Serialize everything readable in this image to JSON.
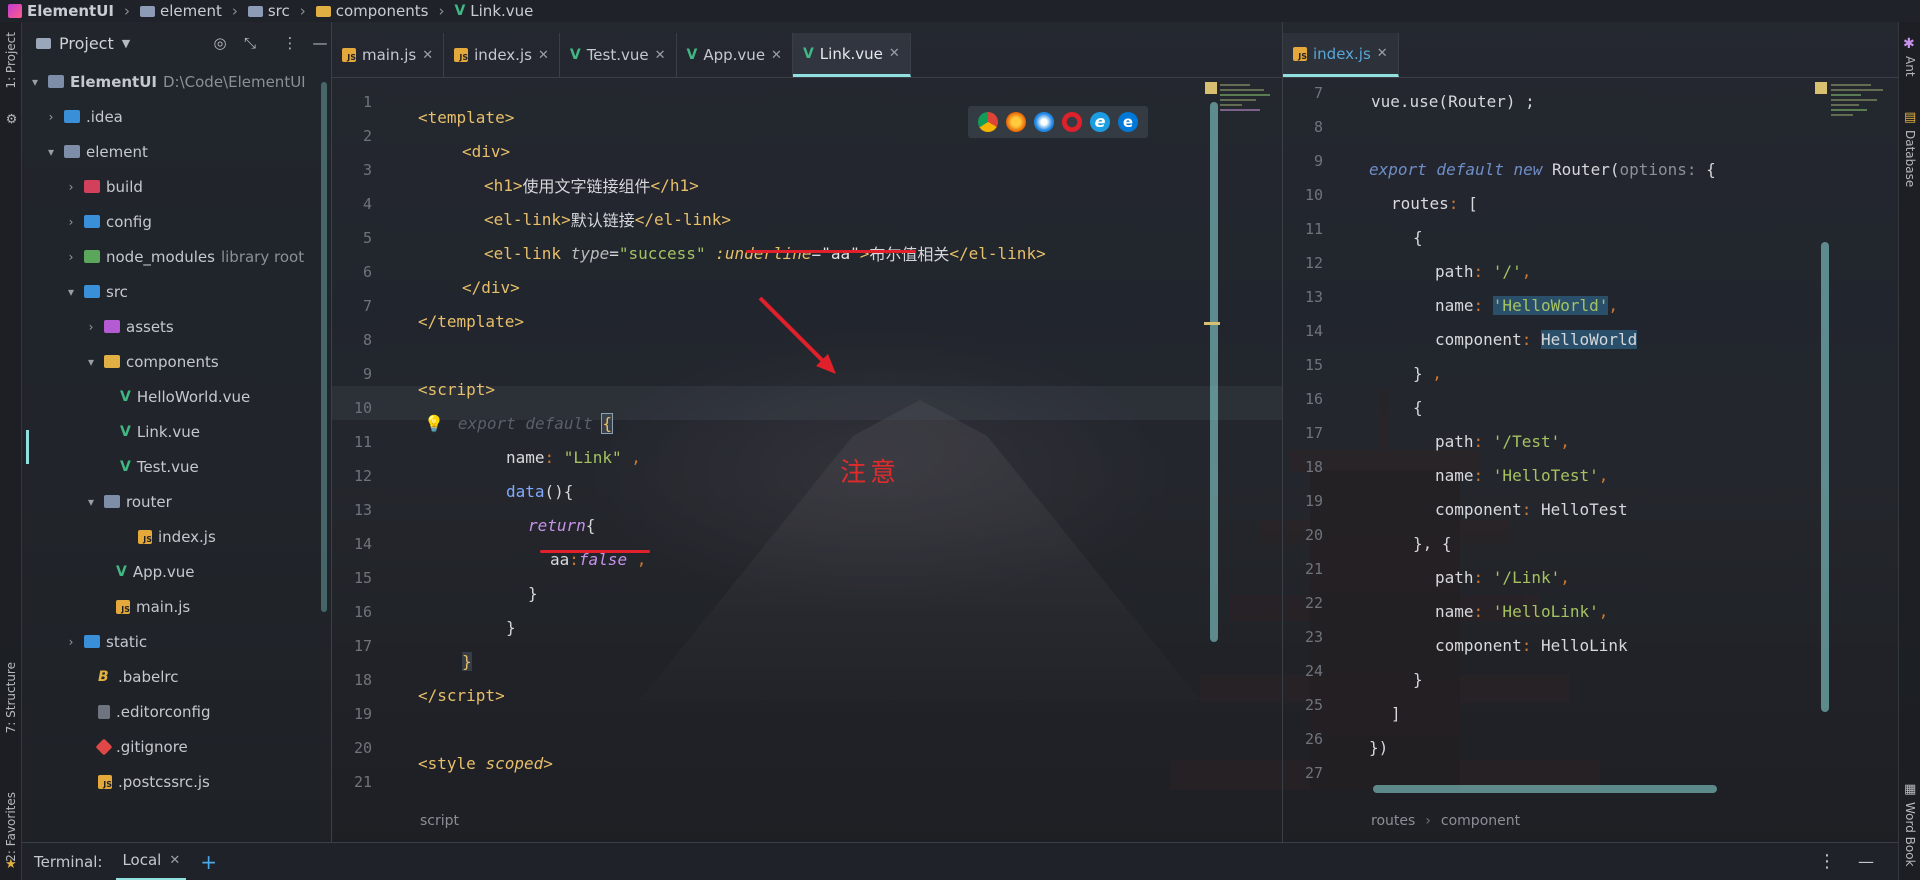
{
  "navbar": {
    "app": "ElementUI",
    "crumbs": [
      "element",
      "src",
      "components",
      "Link.vue"
    ]
  },
  "tool_strip": {
    "left_top": "1: Project",
    "left_mid": "7: Structure",
    "left_bottom": "2: Favorites",
    "right_top": "Ant",
    "right_mid": "Database",
    "right_bottom": "Word Book"
  },
  "project": {
    "title": "Project",
    "root_name": "ElementUI",
    "root_path": "D:\\Code\\ElementUI",
    "items": [
      {
        "label": ".idea",
        "suffix": ""
      },
      {
        "label": "element",
        "suffix": ""
      },
      {
        "label": "build",
        "suffix": ""
      },
      {
        "label": "config",
        "suffix": ""
      },
      {
        "label": "node_modules",
        "suffix": "library root"
      },
      {
        "label": "src",
        "suffix": ""
      },
      {
        "label": "assets",
        "suffix": ""
      },
      {
        "label": "components",
        "suffix": ""
      },
      {
        "label": "HelloWorld.vue",
        "suffix": ""
      },
      {
        "label": "Link.vue",
        "suffix": ""
      },
      {
        "label": "Test.vue",
        "suffix": ""
      },
      {
        "label": "router",
        "suffix": ""
      },
      {
        "label": "index.js",
        "suffix": ""
      },
      {
        "label": "App.vue",
        "suffix": ""
      },
      {
        "label": "main.js",
        "suffix": ""
      },
      {
        "label": "static",
        "suffix": ""
      },
      {
        "label": ".babelrc",
        "suffix": ""
      },
      {
        "label": ".editorconfig",
        "suffix": ""
      },
      {
        "label": ".gitignore",
        "suffix": ""
      },
      {
        "label": ".postcssrc.js",
        "suffix": ""
      }
    ]
  },
  "left_tabs": [
    "main.js",
    "index.js",
    "Test.vue",
    "App.vue",
    "Link.vue"
  ],
  "right_tabs": [
    "index.js"
  ],
  "left_code": {
    "line_numbers": [
      "1",
      "2",
      "3",
      "4",
      "5",
      "6",
      "7",
      "8",
      "9",
      "10",
      "11",
      "12",
      "13",
      "14",
      "15",
      "16",
      "17",
      "18",
      "19",
      "20",
      "21"
    ],
    "l3_text": "使用文字链接组件",
    "l4_text": "默认链接",
    "l5_type": "\"success\"",
    "l5_underline": "\"aa\"",
    "l5_text": "布尔值相关",
    "l11_value": "\"Link\"",
    "l14_value": "false"
  },
  "annotation": "注意",
  "left_status": "script",
  "right_code": {
    "line_numbers": [
      "7",
      "8",
      "9",
      "10",
      "11",
      "12",
      "13",
      "14",
      "15",
      "16",
      "17",
      "18",
      "19",
      "20",
      "21",
      "22",
      "23",
      "24",
      "25",
      "26",
      "27"
    ],
    "l7": "vue.use(Router) ;",
    "hint_options": "options:",
    "p1_path": "'/'",
    "p1_name": "'HelloWorld'",
    "p1_comp": "HelloWorld",
    "p2_path": "'/Test'",
    "p2_name": "'HelloTest'",
    "p2_comp": "HelloTest",
    "p3_path": "'/Link'",
    "p3_name": "'HelloLink'",
    "p3_comp": "HelloLink"
  },
  "right_status": [
    "routes",
    "component"
  ],
  "terminal": {
    "label": "Terminal:",
    "tab": "Local"
  }
}
